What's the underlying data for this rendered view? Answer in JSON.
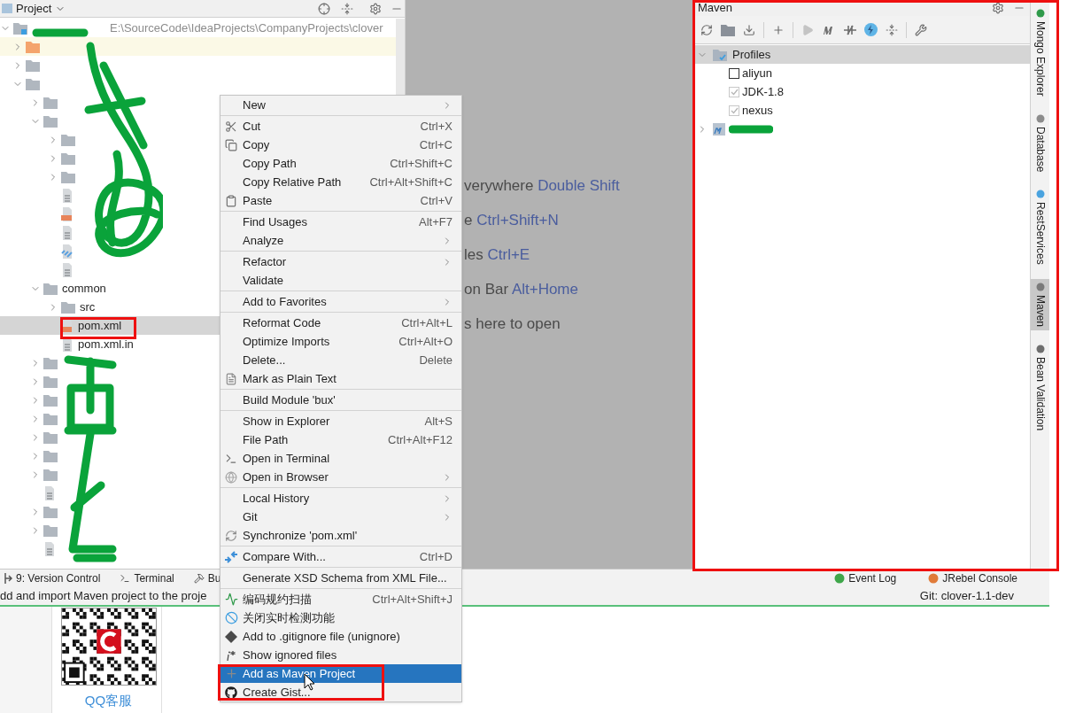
{
  "project_panel": {
    "title": "Project",
    "root": {
      "kind": "module",
      "path": "E:\\SourceCode\\IdeaProjects\\CompanyProjects\\clover",
      "expanded": true,
      "selected": false,
      "children": [
        {
          "kind": "excluded_folder",
          "expanded": false,
          "selected": false
        },
        {
          "kind": "folder",
          "expanded": false,
          "selected": false
        },
        {
          "kind": "folder",
          "expanded": true,
          "selected": false,
          "children": [
            {
              "kind": "folder",
              "expanded": false,
              "selected": false
            },
            {
              "kind": "folder",
              "expanded": true,
              "selected": false,
              "children": [
                {
                  "kind": "folder",
                  "expanded": false,
                  "selected": false
                },
                {
                  "kind": "folder",
                  "expanded": false,
                  "selected": false
                },
                {
                  "kind": "folder",
                  "expanded": false,
                  "selected": false
                },
                {
                  "kind": "file",
                  "selected": false
                },
                {
                  "kind": "xml",
                  "selected": false
                },
                {
                  "kind": "file",
                  "selected": false
                },
                {
                  "kind": "maven",
                  "selected": false
                },
                {
                  "kind": "file",
                  "selected": false
                }
              ]
            },
            {
              "kind": "folder",
              "label": "common",
              "expanded": true,
              "selected": false,
              "children": [
                {
                  "kind": "folder",
                  "label": "src",
                  "expanded": false,
                  "selected": false
                },
                {
                  "kind": "xml",
                  "label": "pom.xml",
                  "selected": true
                },
                {
                  "kind": "file",
                  "label": "pom.xml.in",
                  "selected": false
                }
              ]
            },
            {
              "kind": "folder",
              "expanded": false,
              "selected": false
            },
            {
              "kind": "folder",
              "expanded": false,
              "selected": false
            },
            {
              "kind": "folder",
              "expanded": false,
              "selected": false
            },
            {
              "kind": "folder",
              "expanded": false,
              "selected": false
            },
            {
              "kind": "folder",
              "expanded": false,
              "selected": false
            },
            {
              "kind": "folder",
              "expanded": false,
              "selected": false
            },
            {
              "kind": "folder",
              "expanded": false,
              "selected": false
            },
            {
              "kind": "file",
              "selected": false
            },
            {
              "kind": "folder",
              "expanded": false,
              "selected": false
            },
            {
              "kind": "folder",
              "expanded": false,
              "selected": false
            },
            {
              "kind": "file",
              "selected": false
            }
          ]
        }
      ]
    }
  },
  "editor_hints": [
    {
      "text": "verywhere ",
      "shortcut": "Double Shift"
    },
    {
      "text": "e ",
      "shortcut": "Ctrl+Shift+N"
    },
    {
      "text": "les ",
      "shortcut": "Ctrl+E"
    },
    {
      "text": "on Bar ",
      "shortcut": "Alt+Home"
    },
    {
      "text": "s here to open"
    }
  ],
  "maven_panel": {
    "title": "Maven",
    "tree": [
      {
        "label": "Profiles",
        "expanded": true,
        "selected": true,
        "children": [
          {
            "label": "aliyun",
            "checked": false
          },
          {
            "label": "JDK-1.8",
            "checked": true
          },
          {
            "label": "nexus",
            "checked": true
          }
        ]
      },
      {
        "expanded": false,
        "selected": false
      }
    ]
  },
  "right_tabs": [
    {
      "label": "Mongo Explorer",
      "selected": false
    },
    {
      "label": "Database",
      "selected": false
    },
    {
      "label": "RestServices",
      "selected": false
    },
    {
      "label": "Maven",
      "selected": true
    },
    {
      "label": "Bean Validation",
      "selected": false
    }
  ],
  "tool_tabs": [
    {
      "label": "9: Version Control"
    },
    {
      "label": "Terminal"
    },
    {
      "label": "Bu"
    }
  ],
  "tool_tabs_right": [
    {
      "label": "Event Log"
    },
    {
      "label": "JRebel Console"
    }
  ],
  "status_bar": {
    "message": "dd and import Maven project to the proje",
    "branch": "Git: clover-1.1-dev"
  },
  "web_page": {
    "link": "QQ客服"
  },
  "context_menu": {
    "groups": [
      [
        {
          "label": "New",
          "submenu": true,
          "selected": false
        }
      ],
      [
        {
          "label": "Cut",
          "shortcut": "Ctrl+X",
          "selected": false
        },
        {
          "label": "Copy",
          "shortcut": "Ctrl+C",
          "selected": false
        },
        {
          "label": "Copy Path",
          "shortcut": "Ctrl+Shift+C",
          "selected": false
        },
        {
          "label": "Copy Relative Path",
          "shortcut": "Ctrl+Alt+Shift+C",
          "selected": false
        },
        {
          "label": "Paste",
          "shortcut": "Ctrl+V",
          "selected": false
        }
      ],
      [
        {
          "label": "Find Usages",
          "shortcut": "Alt+F7",
          "selected": false
        },
        {
          "label": "Analyze",
          "submenu": true,
          "selected": false
        }
      ],
      [
        {
          "label": "Refactor",
          "submenu": true,
          "selected": false
        },
        {
          "label": "Validate",
          "selected": false
        }
      ],
      [
        {
          "label": "Add to Favorites",
          "submenu": true,
          "selected": false
        }
      ],
      [
        {
          "label": "Reformat Code",
          "shortcut": "Ctrl+Alt+L",
          "selected": false
        },
        {
          "label": "Optimize Imports",
          "shortcut": "Ctrl+Alt+O",
          "selected": false
        },
        {
          "label": "Delete...",
          "shortcut": "Delete",
          "selected": false
        },
        {
          "label": "Mark as Plain Text",
          "selected": false
        }
      ],
      [
        {
          "label": "Build Module 'bux'",
          "selected": false
        }
      ],
      [
        {
          "label": "Show in Explorer",
          "shortcut": "Alt+S",
          "selected": false
        },
        {
          "label": "File Path",
          "shortcut": "Ctrl+Alt+F12",
          "selected": false
        },
        {
          "label": "Open in Terminal",
          "selected": false
        },
        {
          "label": "Open in Browser",
          "submenu": true,
          "selected": false
        }
      ],
      [
        {
          "label": "Local History",
          "submenu": true,
          "selected": false
        },
        {
          "label": "Git",
          "submenu": true,
          "selected": false
        },
        {
          "label": "Synchronize 'pom.xml'",
          "selected": false
        }
      ],
      [
        {
          "label": "Compare With...",
          "shortcut": "Ctrl+D",
          "selected": false
        }
      ],
      [
        {
          "label": "Generate XSD Schema from XML File...",
          "selected": false
        }
      ],
      [
        {
          "label": "编码规约扫描",
          "shortcut": "Ctrl+Alt+Shift+J",
          "selected": false
        },
        {
          "label": "关闭实时检测功能",
          "selected": false
        },
        {
          "label": "Add to .gitignore file (unignore)",
          "selected": false
        },
        {
          "label": "Show ignored files",
          "selected": false
        },
        {
          "label": "Add as Maven Project",
          "selected": true
        },
        {
          "label": "Create Gist...",
          "selected": false
        }
      ]
    ]
  }
}
